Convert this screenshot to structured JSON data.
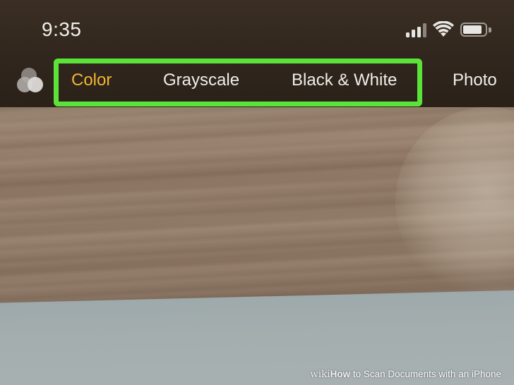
{
  "status_bar": {
    "time": "9:35",
    "icons": [
      "cellular-signal-icon",
      "wifi-icon",
      "battery-icon"
    ]
  },
  "filter_bar": {
    "toggle_icon": "filters-toggle-icon",
    "options": [
      {
        "label": "Color",
        "selected": true
      },
      {
        "label": "Grayscale",
        "selected": false
      },
      {
        "label": "Black & White",
        "selected": false
      },
      {
        "label": "Photo",
        "selected": false
      }
    ]
  },
  "caption": {
    "brand_wiki": "wiki",
    "brand_how": "How",
    "title": " to Scan Documents with an iPhone"
  },
  "colors": {
    "selected_option": "#f2b632",
    "option_text": "#f0eeea",
    "highlight_box": "#5ce33a",
    "bar_background": "#30261d"
  }
}
